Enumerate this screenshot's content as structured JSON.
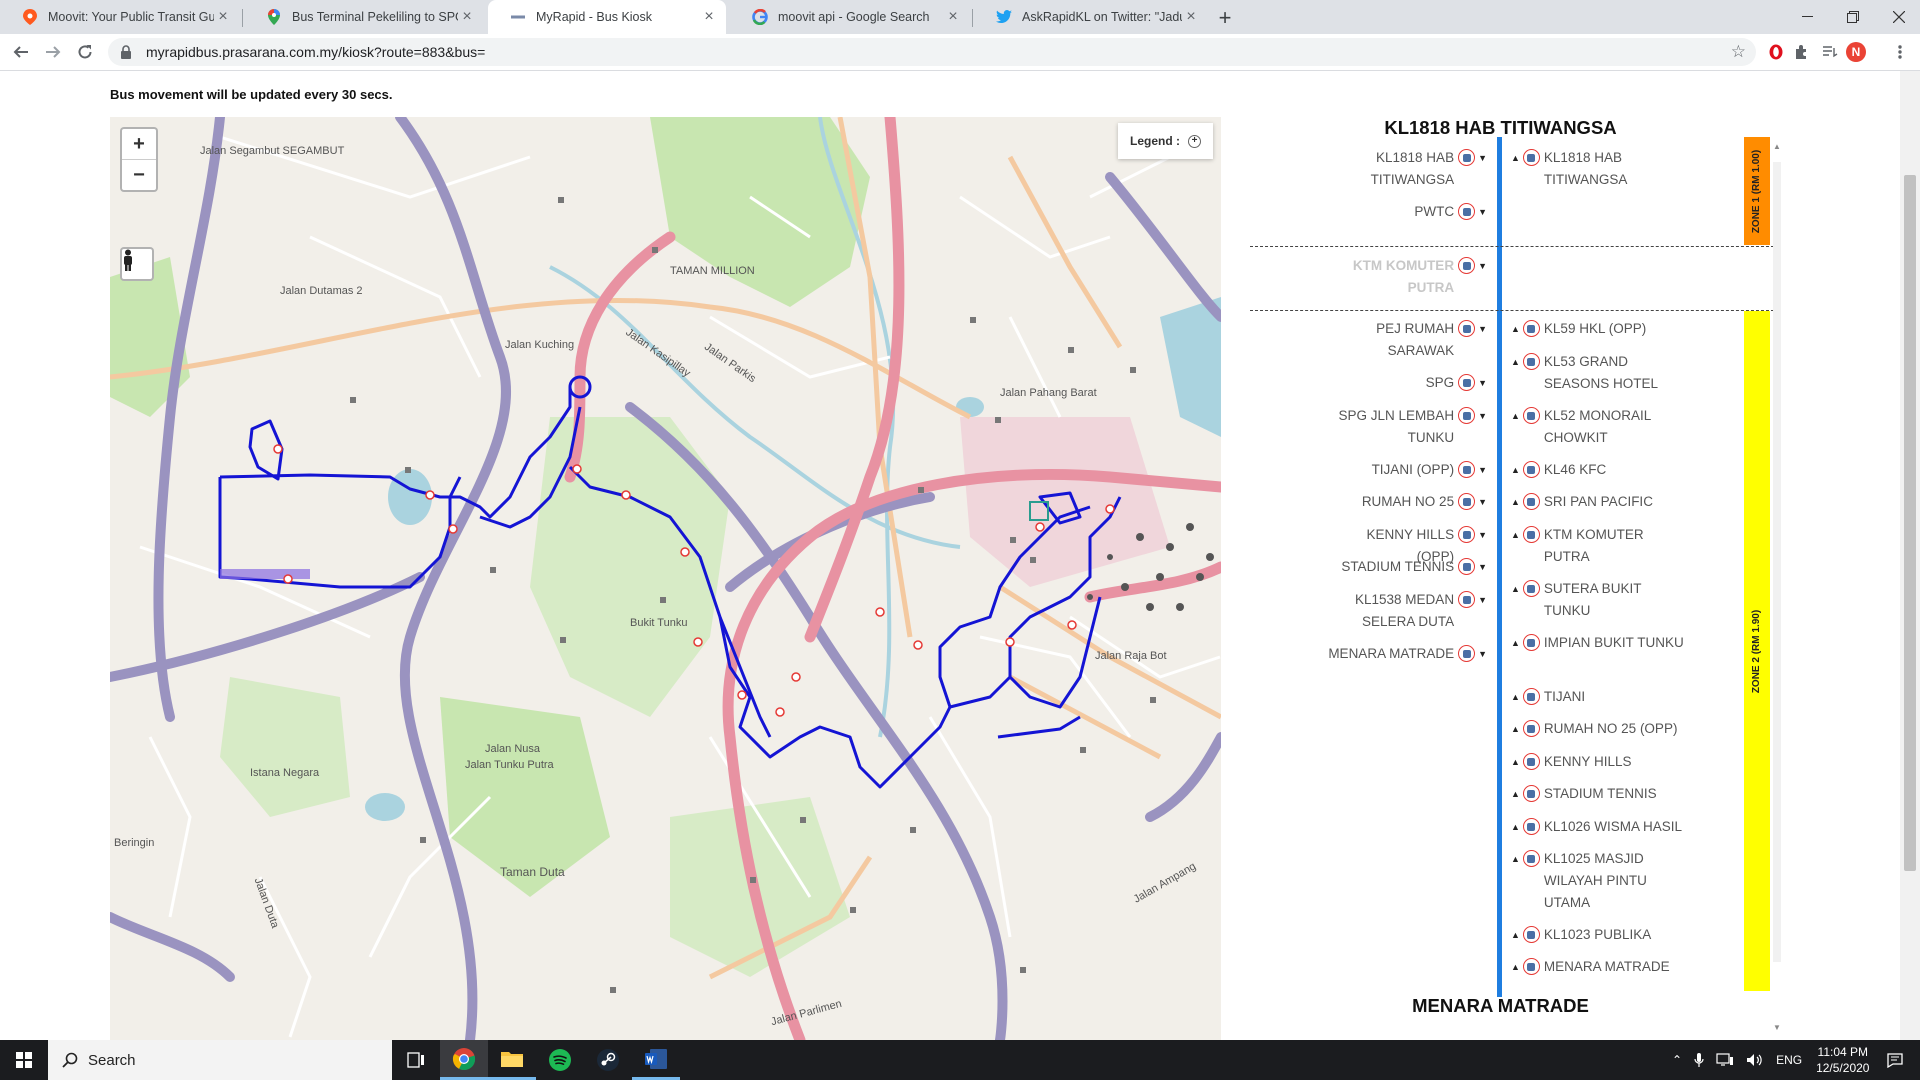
{
  "browser": {
    "tabs": [
      {
        "title": "Moovit: Your Public Transit Guide",
        "icon": "moovit-icon"
      },
      {
        "title": "Bus Terminal Pekeliling to SPG Jln",
        "icon": "google-maps-icon"
      },
      {
        "title": "MyRapid - Bus Kiosk",
        "icon": "myrapid-icon"
      },
      {
        "title": "moovit api - Google Search",
        "icon": "google-icon"
      },
      {
        "title": "AskRapidKL on Twitter: \"Jadual w",
        "icon": "twitter-icon"
      }
    ],
    "active_tab": 2,
    "url": "myrapidbus.prasarana.com.my/kiosk?route=883&bus=",
    "profile_initial": "N"
  },
  "page": {
    "notice": "Bus movement will be updated every 30 secs."
  },
  "map": {
    "zoom_in": "+",
    "zoom_out": "−",
    "legend_label": "Legend :",
    "legend_toggle": "+",
    "labels": {
      "segambut": "Jalan Segambut SEGAMBUT",
      "dutamas": "Jalan Dutamas 2",
      "taman_million": "TAMAN MILLION",
      "kuching": "Jalan Kuching",
      "kasipillay": "Jalan Kasipillay",
      "parkis": "Jalan Parkis",
      "pahang_barat": "Jalan Pahang Barat",
      "bukit_tunku": "Bukit Tunku",
      "nusa": "Jalan Nusa",
      "tunku_putra": "Jalan Tunku Putra",
      "istana": "Istana Negara",
      "taman_duta": "Taman Duta",
      "beringin": "Beringin",
      "raja_bot": "Jalan Raja Bot",
      "parlimen": "Jalan Parlimen",
      "ampang": "Jalan Ampang",
      "duta": "Jalan Duta"
    },
    "colors": {
      "route": "#1414d4",
      "land": "#f2efe9",
      "park": "#c8e6b0",
      "water": "#aad3df",
      "motorway": "#e892a2",
      "trunk": "#9a93c0"
    }
  },
  "route_panel": {
    "origin_title": "KL1818 HAB TITIWANGSA",
    "destination_title": "MENARA MATRADE",
    "left_stops": [
      {
        "name": "KL1818 HAB TITIWANGSA",
        "muted": false
      },
      {
        "name": "PWTC",
        "muted": false
      },
      {
        "name": "KTM KOMUTER PUTRA",
        "muted": true
      },
      {
        "name": "PEJ RUMAH SARAWAK",
        "muted": false
      },
      {
        "name": "SPG",
        "muted": false
      },
      {
        "name": "SPG JLN LEMBAH TUNKU",
        "muted": false
      },
      {
        "name": "TIJANI (OPP)",
        "muted": false
      },
      {
        "name": "RUMAH NO 25",
        "muted": false
      },
      {
        "name": "KENNY HILLS (OPP)",
        "muted": false
      },
      {
        "name": "STADIUM TENNIS",
        "muted": false
      },
      {
        "name": "KL1538 MEDAN SELERA DUTA",
        "muted": false
      },
      {
        "name": "MENARA MATRADE",
        "muted": false
      }
    ],
    "right_stops": [
      {
        "name": "KL1818 HAB TITIWANGSA"
      },
      {
        "name": "KL59 HKL (OPP)"
      },
      {
        "name": "KL53 GRAND SEASONS HOTEL"
      },
      {
        "name": "KL52 MONORAIL CHOWKIT"
      },
      {
        "name": "KL46 KFC"
      },
      {
        "name": "SRI PAN PACIFIC"
      },
      {
        "name": "KTM KOMUTER PUTRA"
      },
      {
        "name": "SUTERA BUKIT TUNKU"
      },
      {
        "name": "IMPIAN BUKIT TUNKU"
      },
      {
        "name": "TIJANI"
      },
      {
        "name": "RUMAH NO 25 (OPP)"
      },
      {
        "name": "KENNY HILLS"
      },
      {
        "name": "STADIUM TENNIS"
      },
      {
        "name": "KL1026 WISMA HASIL"
      },
      {
        "name": "KL1025 MASJID WILAYAH PINTU UTAMA"
      },
      {
        "name": "KL1023 PUBLIKA"
      },
      {
        "name": "MENARA MATRADE"
      }
    ],
    "zones": [
      {
        "label": "ZONE 1 (RM 1.00)",
        "color": "#ff8c00"
      },
      {
        "label": "ZONE 2 (RM 1.90)",
        "color": "#ffff00"
      }
    ],
    "axis_color": "#1f7ee0"
  },
  "taskbar": {
    "search_placeholder": "Search",
    "language": "ENG",
    "time": "11:04 PM",
    "date": "12/5/2020"
  }
}
